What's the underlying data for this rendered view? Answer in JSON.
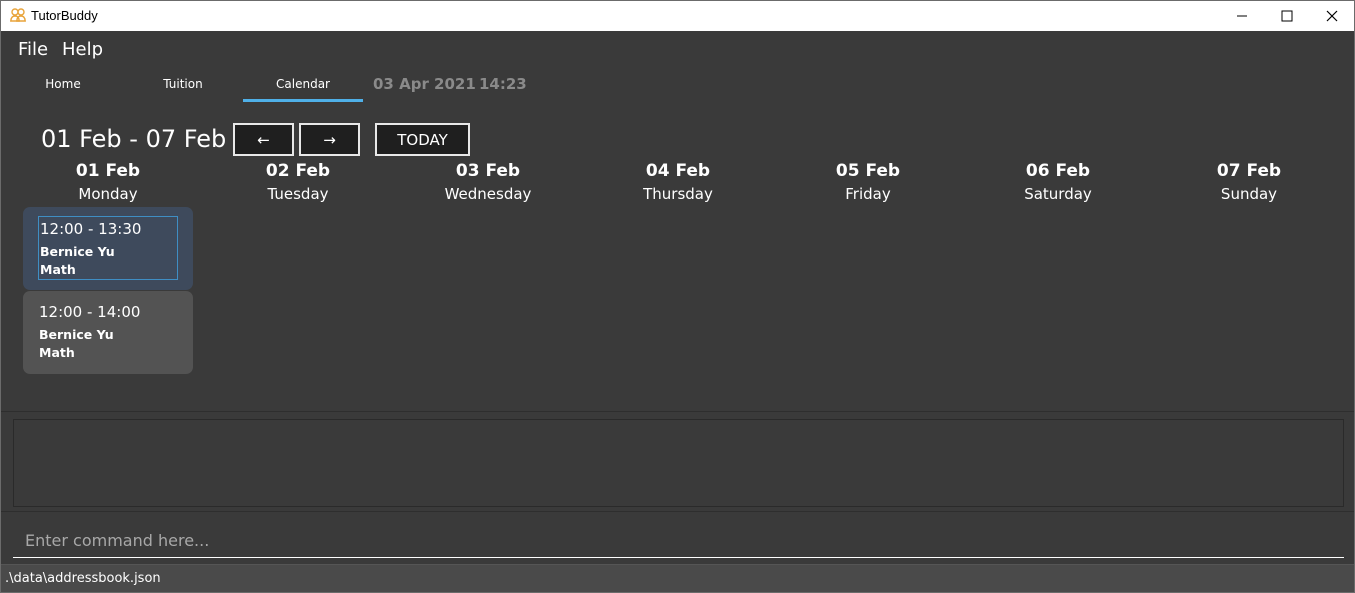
{
  "window": {
    "title": "TutorBuddy",
    "icon": "people-icon"
  },
  "menu": {
    "items": [
      "File",
      "Help"
    ]
  },
  "tabs": {
    "items": [
      "Home",
      "Tuition",
      "Calendar"
    ],
    "active": "Calendar",
    "current_date": "03 Apr 2021",
    "current_time": "14:23"
  },
  "calendar": {
    "week_range": "01 Feb - 07 Feb",
    "prev_label": "←",
    "next_label": "→",
    "today_label": "TODAY",
    "days": [
      {
        "date": "01 Feb",
        "name": "Monday"
      },
      {
        "date": "02 Feb",
        "name": "Tuesday"
      },
      {
        "date": "03 Feb",
        "name": "Wednesday"
      },
      {
        "date": "04 Feb",
        "name": "Thursday"
      },
      {
        "date": "05 Feb",
        "name": "Friday"
      },
      {
        "date": "06 Feb",
        "name": "Saturday"
      },
      {
        "date": "07 Feb",
        "name": "Sunday"
      }
    ],
    "events": [
      {
        "time": "12:00 - 13:30",
        "name": "Bernice Yu",
        "subject": "Math"
      },
      {
        "time": "12:00 - 14:00",
        "name": "Bernice Yu",
        "subject": "Math"
      }
    ]
  },
  "command": {
    "placeholder": "Enter command here..."
  },
  "status": {
    "path": ".\\data\\addressbook.json"
  },
  "colors": {
    "background": "#3a3a3a",
    "tab_accent": "#4fb0e8",
    "event_selected": "#3e4a5c",
    "event_normal": "#535353"
  }
}
